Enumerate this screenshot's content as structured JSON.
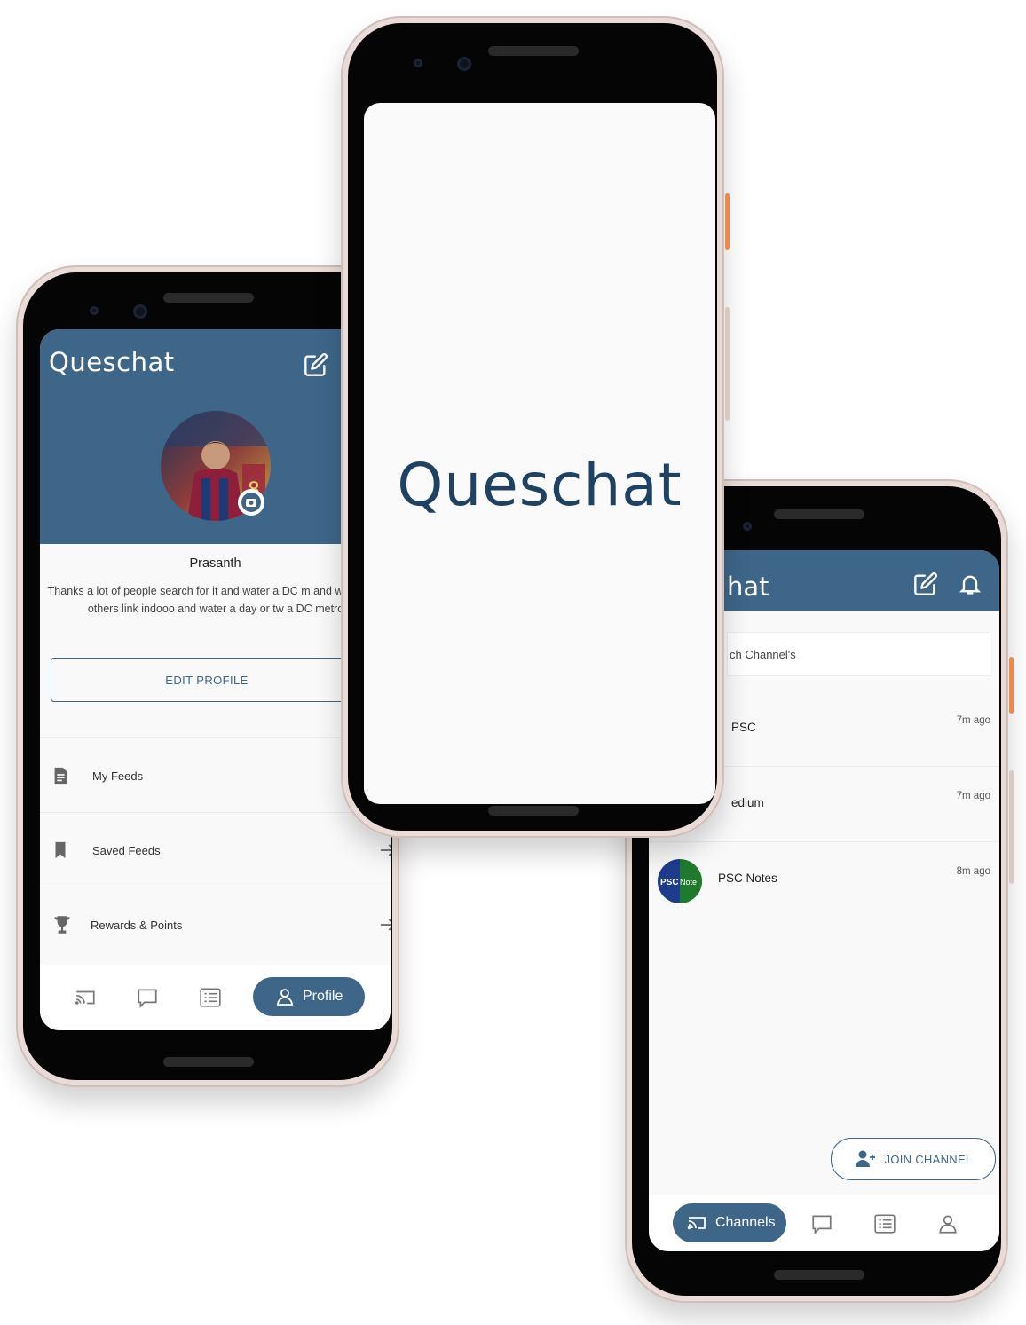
{
  "colors": {
    "primary": "#3d6689",
    "brand_dark": "#1f4262",
    "orange_button": "#ea8a4b"
  },
  "left_phone": {
    "app_title": "Queschat",
    "profile": {
      "name": "Prasanth",
      "bio": "Thanks a lot of people search for it and water a DC m and water and others link indooo and water a day or tw a DC metro",
      "edit_button": "EDIT PROFILE"
    },
    "menu": [
      {
        "label": "My Feeds",
        "icon": "document-icon"
      },
      {
        "label": "Saved Feeds",
        "icon": "bookmark-icon"
      },
      {
        "label": "Rewards & Points",
        "icon": "trophy-icon"
      }
    ],
    "bottom_nav": {
      "active_label": "Profile",
      "icons": [
        "cast-icon",
        "chat-icon",
        "list-icon",
        "person-icon"
      ]
    }
  },
  "center_phone": {
    "splash_logo": "Queschat"
  },
  "right_phone": {
    "app_title_visible": "hat",
    "search_placeholder": "ch Channel's",
    "channels": [
      {
        "name": "PSC",
        "time": "7m ago"
      },
      {
        "name": "edium",
        "time": "7m ago"
      },
      {
        "name": "PSC Notes",
        "time": "8m ago",
        "avatar_text_1": "PSC",
        "avatar_text_2": "Note"
      }
    ],
    "join_button": "JOIN CHANNEL",
    "bottom_nav": {
      "active_label": "Channels",
      "icons": [
        "cast-icon",
        "chat-icon",
        "list-icon",
        "person-icon"
      ]
    }
  }
}
